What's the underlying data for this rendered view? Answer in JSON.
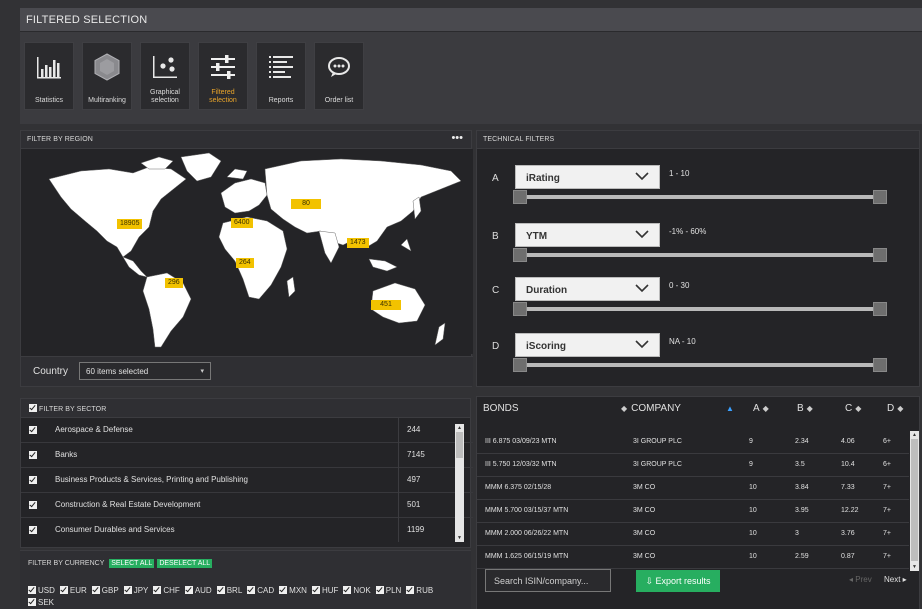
{
  "header": {
    "title": "FILTERED SELECTION"
  },
  "toolbar": {
    "buttons": [
      {
        "label": "Statistics",
        "icon": "bar-chart-icon"
      },
      {
        "label": "Multiranking",
        "icon": "hexagon-icon"
      },
      {
        "label": "Graphical selection",
        "icon": "scatter-icon"
      },
      {
        "label": "Filtered selection",
        "icon": "sliders-icon",
        "active": true
      },
      {
        "label": "Reports",
        "icon": "list-icon"
      },
      {
        "label": "Order list",
        "icon": "chat-icon"
      }
    ]
  },
  "region_panel": {
    "title": "FILTER BY REGION",
    "menu": "•••",
    "regions": [
      {
        "name": "North America",
        "count": "18905"
      },
      {
        "name": "Europe",
        "count": "6400"
      },
      {
        "name": "Eastern Europe / Russia",
        "count": "80"
      },
      {
        "name": "Asia",
        "count": "1473"
      },
      {
        "name": "Africa",
        "count": "264"
      },
      {
        "name": "South America",
        "count": "296"
      },
      {
        "name": "Oceania",
        "count": "451"
      }
    ],
    "country_label": "Country",
    "country_value": "60 items selected"
  },
  "technical_filters": {
    "title": "TECHNICAL FILTERS",
    "rows": [
      {
        "letter": "A",
        "field": "iRating",
        "range": "1  -  10"
      },
      {
        "letter": "B",
        "field": "YTM",
        "range": "-1%  -  60%"
      },
      {
        "letter": "C",
        "field": "Duration",
        "range": "0  -  30"
      },
      {
        "letter": "D",
        "field": "iScoring",
        "range": "NA  -  10"
      }
    ]
  },
  "sector_panel": {
    "title": "FILTER BY SECTOR",
    "rows": [
      {
        "name": "Aerospace & Defense",
        "count": "244"
      },
      {
        "name": "Banks",
        "count": "7145"
      },
      {
        "name": "Business Products & Services, Printing and Publishing",
        "count": "497"
      },
      {
        "name": "Construction & Real Estate Development",
        "count": "501"
      },
      {
        "name": "Consumer Durables and Services",
        "count": "1199"
      }
    ]
  },
  "currency_panel": {
    "title": "FILTER BY CURRENCY",
    "select_all": "SELECT ALL",
    "deselect_all": "DESELECT ALL",
    "currencies": [
      "USD",
      "EUR",
      "GBP",
      "JPY",
      "CHF",
      "AUD",
      "BRL",
      "CAD",
      "MXN",
      "HUF",
      "NOK",
      "PLN",
      "RUB",
      "SEK"
    ]
  },
  "bonds": {
    "columns": [
      "BONDS",
      "COMPANY",
      "A",
      "B",
      "C",
      "D"
    ],
    "rows": [
      {
        "bond": "III 6.875 03/09/23 MTN",
        "company": "3I GROUP PLC",
        "a": "9",
        "b": "2.34",
        "c": "4.06",
        "d": "6+"
      },
      {
        "bond": "III 5.750 12/03/32 MTN",
        "company": "3I GROUP PLC",
        "a": "9",
        "b": "3.5",
        "c": "10.4",
        "d": "6+"
      },
      {
        "bond": "MMM 6.375 02/15/28",
        "company": "3M CO",
        "a": "10",
        "b": "3.84",
        "c": "7.33",
        "d": "7+"
      },
      {
        "bond": "MMM 5.700 03/15/37 MTN",
        "company": "3M CO",
        "a": "10",
        "b": "3.95",
        "c": "12.22",
        "d": "7+"
      },
      {
        "bond": "MMM 2.000 06/26/22 MTN",
        "company": "3M CO",
        "a": "10",
        "b": "3",
        "c": "3.76",
        "d": "7+"
      },
      {
        "bond": "MMM 1.625 06/15/19 MTN",
        "company": "3M CO",
        "a": "10",
        "b": "2.59",
        "c": "0.87",
        "d": "7+"
      }
    ],
    "search_placeholder": "Search ISIN/company...",
    "export_label": "Export results",
    "prev_label": "◂ Prev",
    "next_label": "Next ▸"
  },
  "colors": {
    "background": "#323235",
    "panel": "#242427",
    "accent_green": "#27ae60",
    "badge_yellow": "#f2c200",
    "active_orange": "#e8a42a"
  }
}
